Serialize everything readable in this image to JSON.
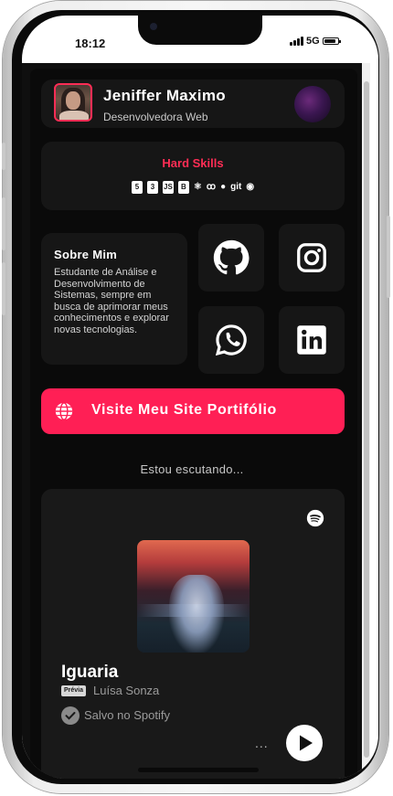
{
  "status_bar": {
    "time": "18:12",
    "network": "5G",
    "battery_level": 0.9
  },
  "profile": {
    "name": "Jeniffer Maximo",
    "role": "Desenvolvedora Web"
  },
  "skills": {
    "title": "Hard Skills",
    "icons": [
      "html5-icon",
      "css3-icon",
      "javascript-icon",
      "bootstrap-icon",
      "react-icon",
      "sass-icon",
      "github-octocat-icon",
      "git-icon",
      "github-icon"
    ],
    "git_label": "git"
  },
  "about": {
    "title": "Sobre Mim",
    "text": "Estudante de Análise e Desenvolvimento de Sistemas, sempre em busca de aprimorar meus conhecimentos e explorar novas tecnologias."
  },
  "social": [
    "github-icon",
    "instagram-icon",
    "whatsapp-icon",
    "linkedin-icon"
  ],
  "site_button": {
    "label": "Visite Meu Site Portifólio"
  },
  "listening_label": "Estou escutando...",
  "spotify": {
    "track": "Iguaria",
    "explicit_tag": "Prévia",
    "artist": "Luísa Sonza",
    "saved": "Salvo no Spotify",
    "more": "..."
  }
}
